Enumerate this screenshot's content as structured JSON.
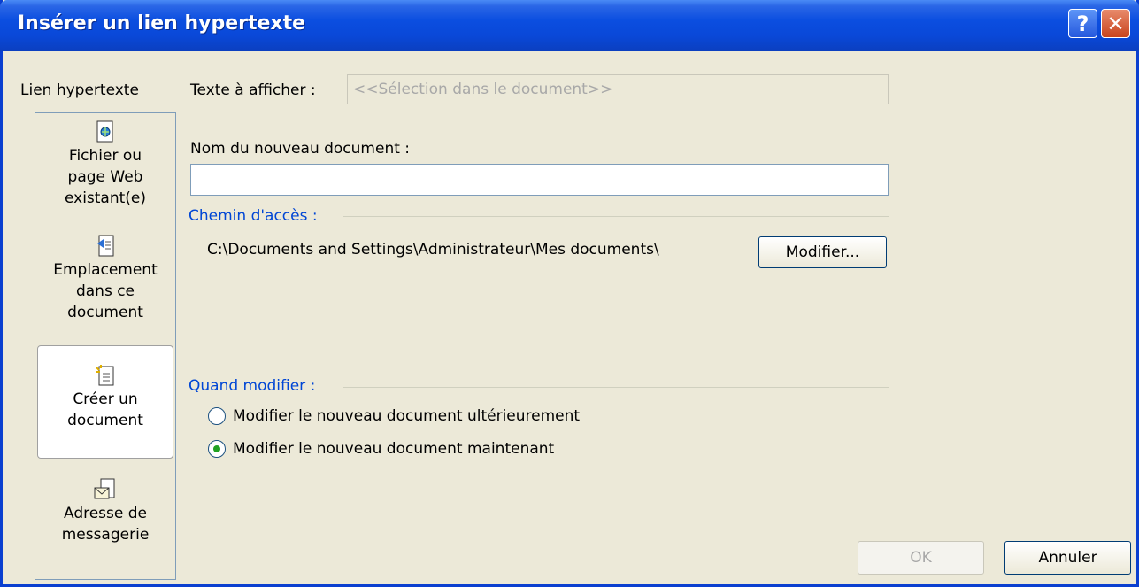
{
  "window": {
    "title": "Insérer un lien hypertexte",
    "help_glyph": "?",
    "close_glyph": "✕"
  },
  "nav": {
    "heading": "Lien hypertexte",
    "items": [
      {
        "label_lines": [
          "Fichier ou",
          "page Web",
          "existant(e)"
        ],
        "icon": "document-globe-icon"
      },
      {
        "label_lines": [
          "Emplacement",
          "dans ce",
          "document"
        ],
        "icon": "document-bookmark-icon"
      },
      {
        "label_lines": [
          "Créer un",
          "document"
        ],
        "icon": "new-document-icon"
      },
      {
        "label_lines": [
          "Adresse de",
          "messagerie"
        ],
        "icon": "envelope-icon"
      }
    ],
    "selected_index": 2
  },
  "form": {
    "text_to_display_label": "Texte à afficher :",
    "text_to_display_value": "<<Sélection dans le document>>",
    "new_doc_name_label": "Nom du nouveau document :",
    "new_doc_name_value": "",
    "path_section_title": "Chemin d'accès :",
    "path_value": "C:\\Documents and Settings\\Administrateur\\Mes documents\\",
    "modify_button_label": "Modifier...",
    "when_section_title": "Quand modifier :",
    "radio_later": "Modifier le nouveau document ultérieurement",
    "radio_now": "Modifier le nouveau document maintenant",
    "selected_radio": "now"
  },
  "buttons": {
    "ok": "OK",
    "cancel": "Annuler"
  }
}
